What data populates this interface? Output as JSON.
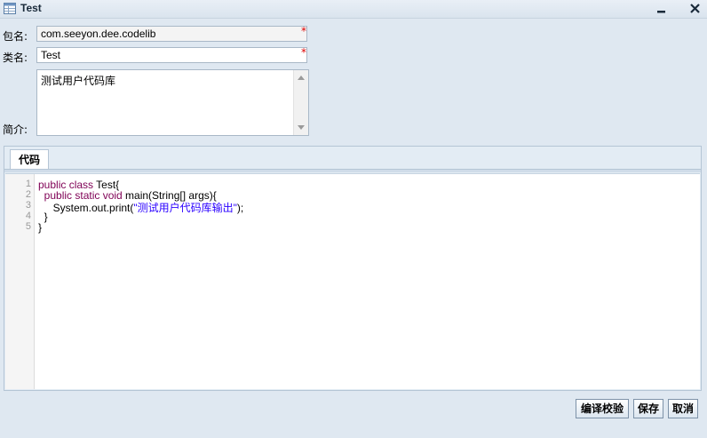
{
  "window": {
    "title": "Test"
  },
  "form": {
    "package_label": "包名:",
    "package_value": "com.seeyon.dee.codelib",
    "class_label": "类名:",
    "class_value": "Test",
    "desc_label": "简介:",
    "desc_value": "测试用户代码库",
    "required_mark": "*"
  },
  "tabs": [
    {
      "label": "代码"
    }
  ],
  "code": {
    "line_numbers": [
      "1",
      "2",
      "3",
      "4",
      "5"
    ],
    "lines": [
      {
        "kw": "public class ",
        "rest": "Test{"
      },
      {
        "kw": "  public static void ",
        "rest": "main(String[] args){"
      },
      {
        "pre": "     System.out.print(",
        "str": "\"测试用户代码库输出\"",
        "post": ");"
      },
      {
        "rest": "  }"
      },
      {
        "rest": "}"
      }
    ]
  },
  "buttons": {
    "compile_label": "编译校验",
    "save_label": "保存",
    "cancel_label": "取消"
  },
  "colors": {
    "keyword": "#7f0055",
    "string": "#2a00ff",
    "required": "#dd0000"
  }
}
